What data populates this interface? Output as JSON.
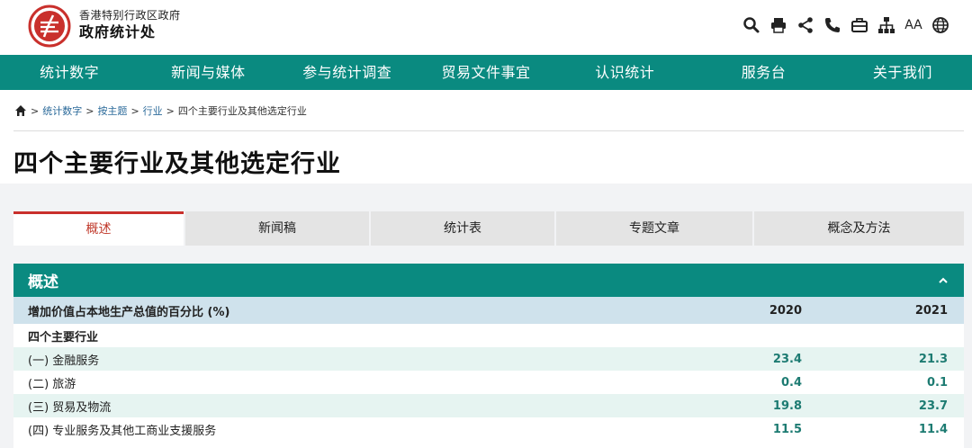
{
  "header": {
    "org_sub": "香港特别行政区政府",
    "org_main": "政府统计处",
    "tools": [
      "search-icon",
      "print-icon",
      "share-icon",
      "phone-icon",
      "briefcase-icon",
      "sitemap-icon",
      "font-size-icon",
      "globe-icon"
    ],
    "font_size_label": "AA"
  },
  "nav": [
    "统计数字",
    "新闻与媒体",
    "参与统计调查",
    "贸易文件事宜",
    "认识统计",
    "服务台",
    "关于我们"
  ],
  "breadcrumb": {
    "sep": ">",
    "items": [
      "统计数字",
      "按主题",
      "行业"
    ],
    "current": "四个主要行业及其他选定行业"
  },
  "page_title": "四个主要行业及其他选定行业",
  "tabs": [
    "概述",
    "新闻稿",
    "统计表",
    "专题文章",
    "概念及方法"
  ],
  "panel": {
    "title": "概述",
    "table": {
      "header": [
        "增加价值占本地生产总值的百分比 (%)",
        "2020",
        "2021"
      ],
      "group": "四个主要行业",
      "rows": [
        [
          "(一) 金融服务",
          "23.4",
          "21.3"
        ],
        [
          "(二) 旅游",
          "0.4",
          "0.1"
        ],
        [
          "(三) 贸易及物流",
          "19.8",
          "23.7"
        ],
        [
          "(四) 专业服务及其他工商业支援服务",
          "11.5",
          "11.4"
        ]
      ]
    }
  },
  "colors": {
    "brand_teal": "#0a8a80",
    "accent_red": "#c9302c",
    "value_teal": "#1d7b72"
  }
}
